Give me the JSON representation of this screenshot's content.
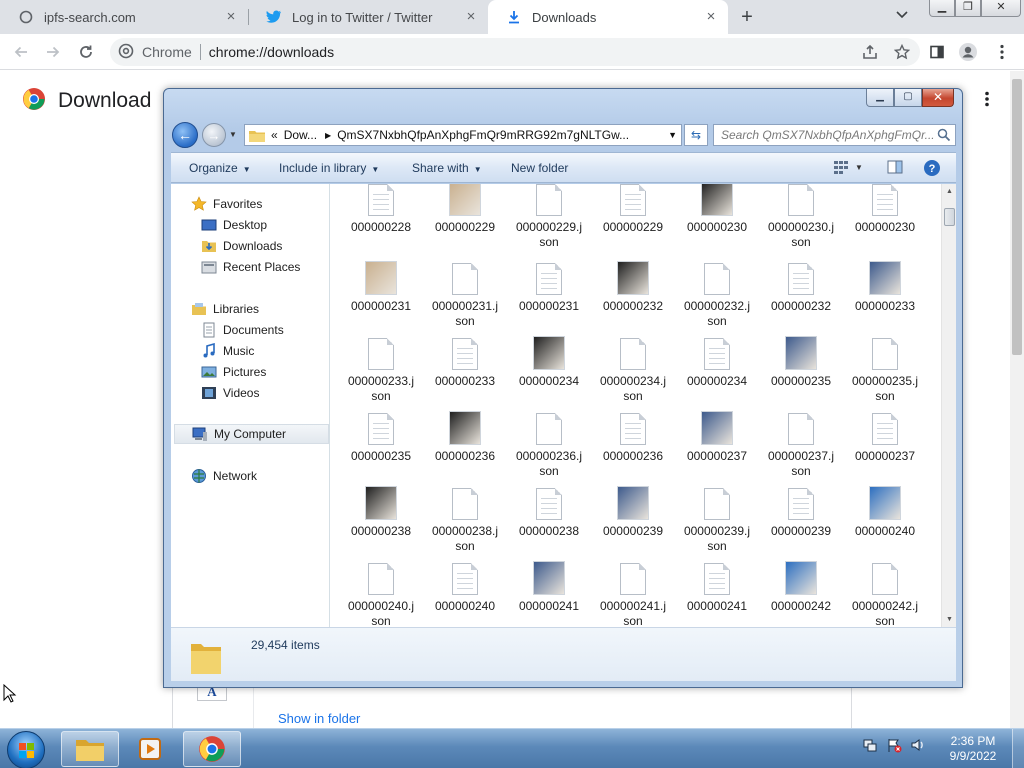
{
  "browser": {
    "tabs": [
      {
        "title": "ipfs-search.com",
        "icon": "globe-icon"
      },
      {
        "title": "Log in to Twitter / Twitter",
        "icon": "twitter-bird-icon"
      },
      {
        "title": "Downloads",
        "icon": "download-arrow-icon"
      }
    ],
    "omnibox": {
      "origin": "Chrome",
      "url": "chrome://downloads"
    }
  },
  "downloads_page": {
    "title": "Download",
    "show_in_folder": "Show in folder"
  },
  "explorer": {
    "path": {
      "prefix": "«",
      "crumbs": [
        "Dow...",
        "QmSX7NxbhQfpAnXphgFmQr9mRRG92m7gNLTGw..."
      ]
    },
    "search_placeholder": "Search QmSX7NxbhQfpAnXphgFmQr...",
    "commands": {
      "organize": "Organize",
      "include_in_library": "Include in library",
      "share_with": "Share with",
      "new_folder": "New folder"
    },
    "nav": {
      "favorites": "Favorites",
      "desktop": "Desktop",
      "downloads": "Downloads",
      "recent_places": "Recent Places",
      "libraries": "Libraries",
      "documents": "Documents",
      "music": "Music",
      "pictures": "Pictures",
      "videos": "Videos",
      "my_computer": "My Computer",
      "network": "Network"
    },
    "files": [
      [
        {
          "name": "000000228",
          "kind": "doc"
        },
        {
          "name": "000000229",
          "kind": "image"
        },
        {
          "name": "000000229.json",
          "kind": "blank"
        },
        {
          "name": "000000229",
          "kind": "doc"
        },
        {
          "name": "000000230",
          "kind": "image"
        },
        {
          "name": "000000230.json",
          "kind": "blank"
        },
        {
          "name": "000000230",
          "kind": "doc"
        }
      ],
      [
        {
          "name": "000000231",
          "kind": "image"
        },
        {
          "name": "000000231.json",
          "kind": "blank"
        },
        {
          "name": "000000231",
          "kind": "doc"
        },
        {
          "name": "000000232",
          "kind": "image"
        },
        {
          "name": "000000232.json",
          "kind": "blank"
        },
        {
          "name": "000000232",
          "kind": "doc"
        },
        {
          "name": "000000233",
          "kind": "image"
        }
      ],
      [
        {
          "name": "000000233.json",
          "kind": "blank"
        },
        {
          "name": "000000233",
          "kind": "doc"
        },
        {
          "name": "000000234",
          "kind": "image"
        },
        {
          "name": "000000234.json",
          "kind": "blank"
        },
        {
          "name": "000000234",
          "kind": "doc"
        },
        {
          "name": "000000235",
          "kind": "image"
        },
        {
          "name": "000000235.json",
          "kind": "blank"
        }
      ],
      [
        {
          "name": "000000235",
          "kind": "doc"
        },
        {
          "name": "000000236",
          "kind": "image"
        },
        {
          "name": "000000236.json",
          "kind": "blank"
        },
        {
          "name": "000000236",
          "kind": "doc"
        },
        {
          "name": "000000237",
          "kind": "image"
        },
        {
          "name": "000000237.json",
          "kind": "blank"
        },
        {
          "name": "000000237",
          "kind": "doc"
        }
      ],
      [
        {
          "name": "000000238",
          "kind": "image"
        },
        {
          "name": "000000238.json",
          "kind": "blank"
        },
        {
          "name": "000000238",
          "kind": "doc"
        },
        {
          "name": "000000239",
          "kind": "image"
        },
        {
          "name": "000000239.json",
          "kind": "blank"
        },
        {
          "name": "000000239",
          "kind": "doc"
        },
        {
          "name": "000000240",
          "kind": "image"
        }
      ],
      [
        {
          "name": "000000240.json",
          "kind": "blank"
        },
        {
          "name": "000000240",
          "kind": "doc"
        },
        {
          "name": "000000241",
          "kind": "image"
        },
        {
          "name": "000000241.json",
          "kind": "blank"
        },
        {
          "name": "000000241",
          "kind": "doc"
        },
        {
          "name": "000000242",
          "kind": "image"
        },
        {
          "name": "000000242.json",
          "kind": "blank"
        }
      ]
    ],
    "item_count": "29,454 items"
  },
  "taskbar": {
    "time": "2:36 PM",
    "date": "9/9/2022"
  },
  "colors": {
    "chrome_accent": "#1a73e8",
    "explorer_frame": "#b9cfe9",
    "taskbar": "#5c89b9"
  }
}
